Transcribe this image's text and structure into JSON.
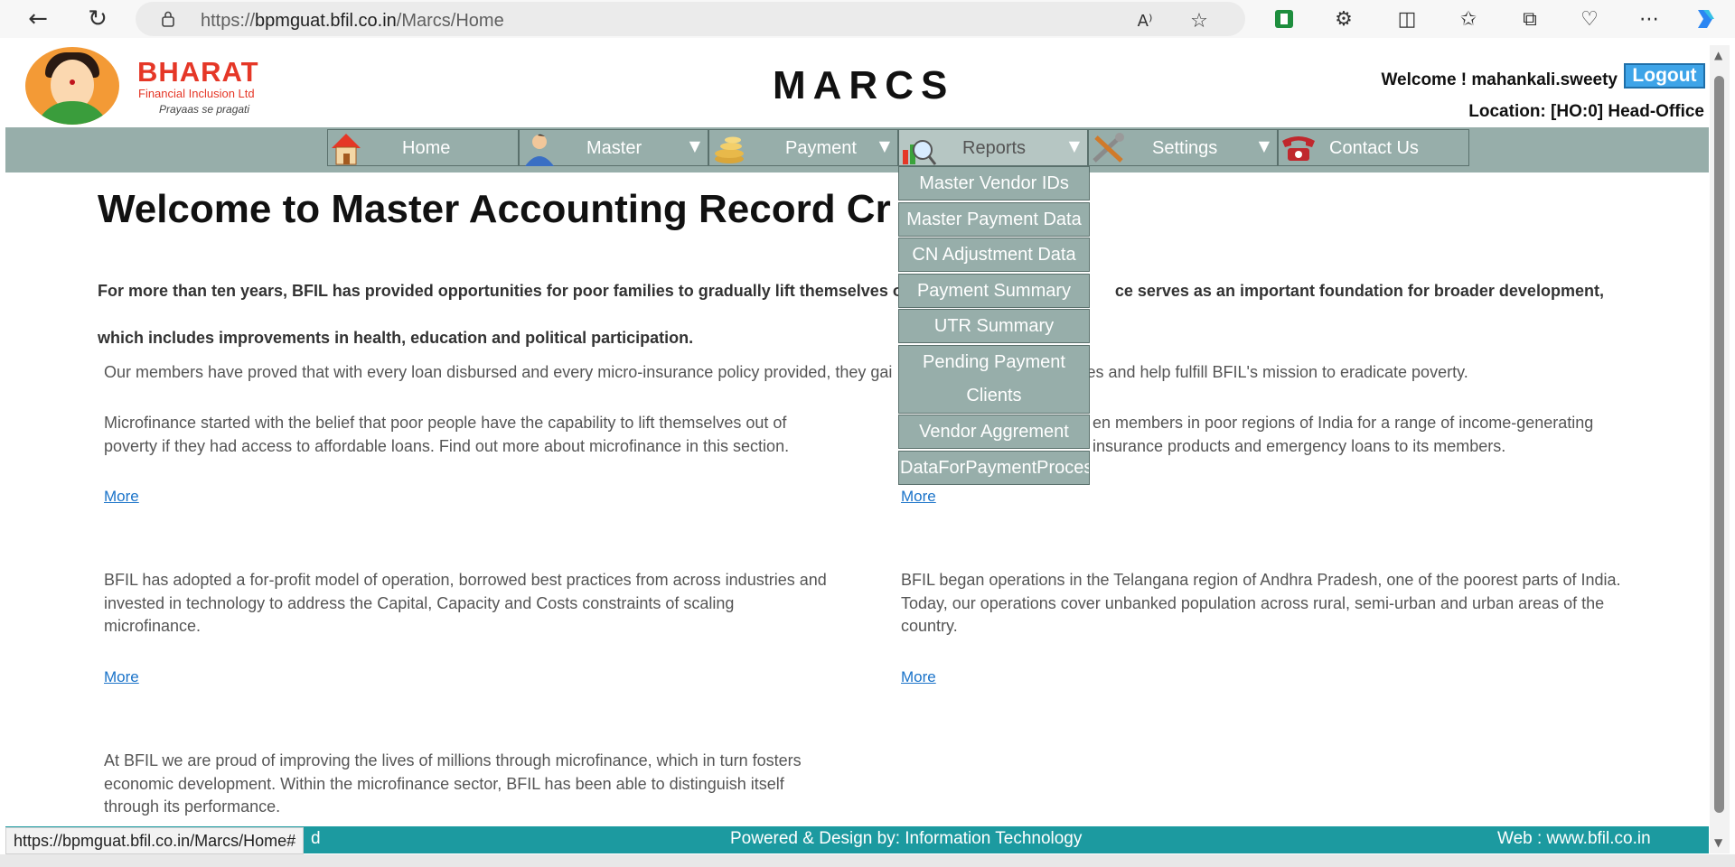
{
  "browser": {
    "url_prefix": "https://",
    "url_host": "bpmguat.bfil.co.in",
    "url_path": "/Marcs/Home",
    "status_url": "https://bpmguat.bfil.co.in/Marcs/Home#"
  },
  "header": {
    "brand": "BHARAT",
    "brand_sub": "Financial Inclusion Ltd",
    "tagline": "Prayaas se pragati",
    "app_title": "MARCS",
    "welcome": "Welcome ! mahankali.sweety",
    "logout": "Logout",
    "location": "Location:  [HO:0] Head-Office"
  },
  "menu": {
    "home": "Home",
    "master": "Master",
    "payment": "Payment",
    "reports": "Reports",
    "settings": "Settings",
    "contact": "Contact Us",
    "arrow": "▼"
  },
  "reports_dropdown": [
    "Master Vendor IDs",
    "Master Payment Data",
    "CN Adjustment Data",
    "Payment Summary",
    "UTR Summary",
    "Pending Payment Clients",
    "Vendor Aggrement",
    "DataForPaymentProcess"
  ],
  "content": {
    "headline": "Welcome to Master Accounting Record Cr",
    "intro_1a": "For more than ten years, BFIL has provided opportunities for poor families to gradually lift themselves o",
    "intro_1b": "ce serves as an important foundation for broader development,",
    "intro_2": "which includes improvements in health, education and political participation.",
    "members_a": "Our members have proved that with every loan disbursed and every micro-insurance policy provided, they gai",
    "members_b": "es and help fulfill BFIL's mission to eradicate poverty.",
    "p1": "Microfinance started with the belief that poor people have the capability to lift themselves out of poverty if they had access to affordable loans. Find out more about microfinance in this section.",
    "p2a": "en members in poor regions of India for a range of income-generating",
    "p2b": "insurance products and emergency loans to its members.",
    "p3": "BFIL has adopted a for-profit model of operation, borrowed best practices from across industries and invested in technology to address the Capital, Capacity and Costs constraints of scaling microfinance.",
    "p4": "BFIL began operations in the Telangana region of Andhra Pradesh, one of the poorest parts of India. Today, our operations cover unbanked population across rural, semi-urban and urban areas of the country.",
    "p5": "At BFIL we are proud of improving the lives of millions through microfinance, which in turn fosters economic development. Within the microfinance sector, BFIL has been able to distinguish itself through its performance.",
    "more": "More"
  },
  "footer": {
    "left_fragment": "d",
    "center": "Powered & Design by: Information Technology",
    "right": "Web : www.bfil.co.in"
  },
  "colors": {
    "menu_bg": "#97aeaa",
    "footer_bg": "#1c9aa0",
    "brand_red": "#e53727",
    "logout_blue": "#3ea4e8"
  },
  "icons": [
    "back-arrow-icon",
    "refresh-icon",
    "lock-icon",
    "read-aloud-icon",
    "favorite-star-icon",
    "extension-icon",
    "split-screen-icon",
    "favorites-icon",
    "collections-icon",
    "health-icon",
    "more-icon",
    "copilot-icon",
    "house-icon",
    "person-icon",
    "coins-icon",
    "magnifier-icon",
    "tools-icon",
    "telephone-icon"
  ]
}
